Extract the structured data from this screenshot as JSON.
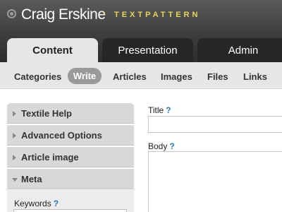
{
  "header": {
    "site_name": "Craig Erskine",
    "separator": "•",
    "app_name": "TEXTPATTERN",
    "icon": "eye-icon"
  },
  "main_tabs": [
    {
      "label": "Content",
      "active": true
    },
    {
      "label": "Presentation",
      "active": false
    },
    {
      "label": "Admin",
      "active": false
    }
  ],
  "sub_tabs": [
    {
      "label": "Categories",
      "active": false
    },
    {
      "label": "Write",
      "active": true
    },
    {
      "label": "Articles",
      "active": false
    },
    {
      "label": "Images",
      "active": false
    },
    {
      "label": "Files",
      "active": false
    },
    {
      "label": "Links",
      "active": false
    }
  ],
  "side_panes": [
    {
      "label": "Textile Help",
      "expanded": false
    },
    {
      "label": "Advanced Options",
      "expanded": false
    },
    {
      "label": "Article image",
      "expanded": false
    },
    {
      "label": "Meta",
      "expanded": true
    }
  ],
  "meta": {
    "keywords_label": "Keywords",
    "keywords_value": "",
    "help": "?"
  },
  "form": {
    "title_label": "Title",
    "title_value": "",
    "body_label": "Body",
    "body_value": "",
    "help": "?"
  },
  "colors": {
    "accent_yellow": "#e5d75a",
    "help_blue": "#2a7ab8",
    "active_pill": "#999999"
  }
}
